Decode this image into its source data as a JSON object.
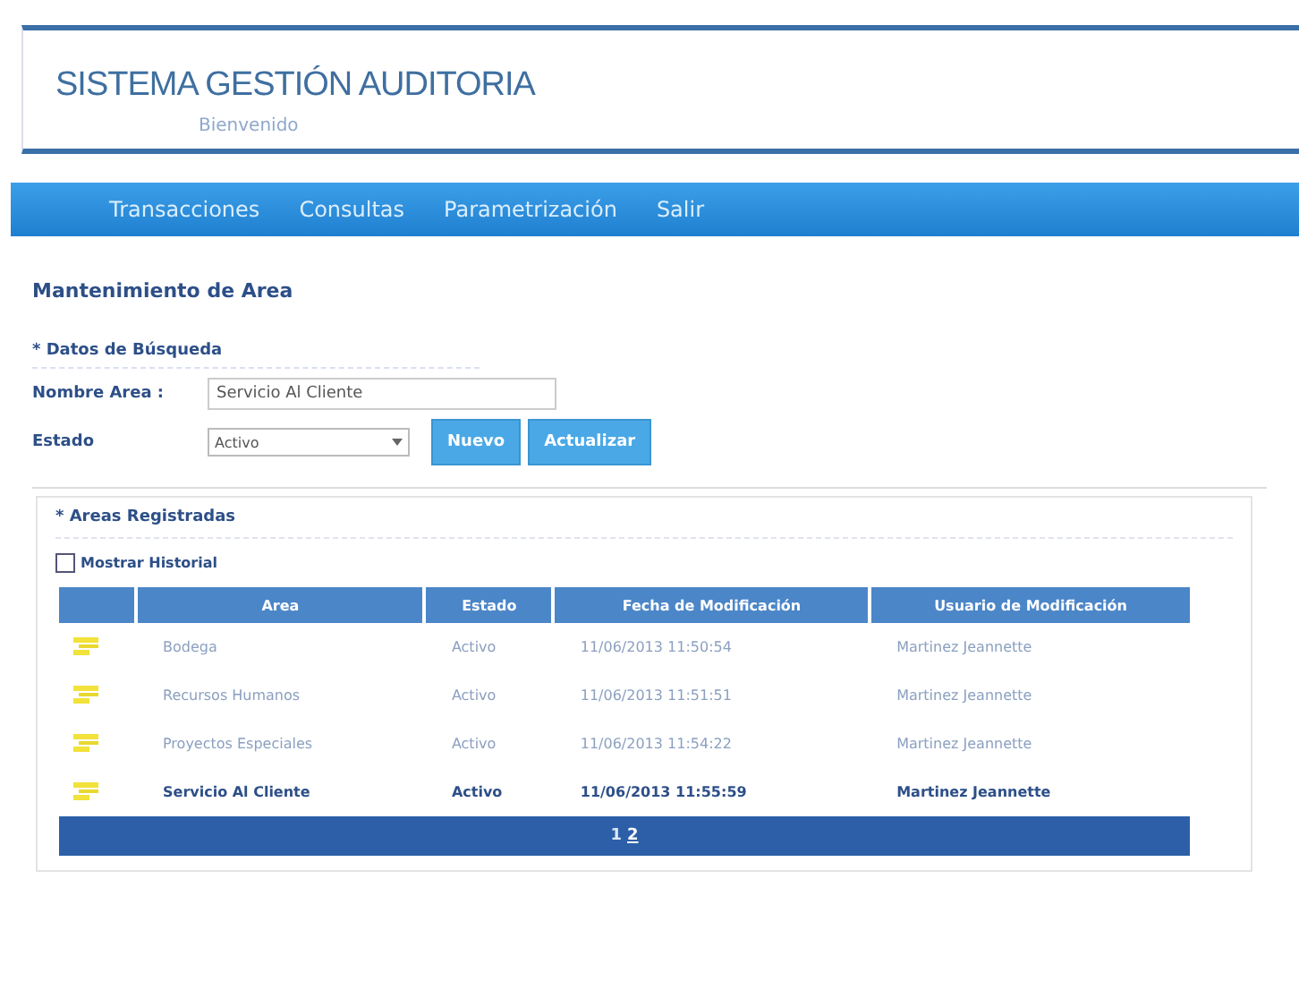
{
  "header": {
    "title": "SISTEMA GESTIÓN AUDITORIA",
    "subtitle": "Bienvenido"
  },
  "nav": {
    "items": [
      {
        "label": "Transacciones"
      },
      {
        "label": "Consultas"
      },
      {
        "label": "Parametrización"
      },
      {
        "label": "Salir"
      }
    ]
  },
  "page_title": "Mantenimiento de Area",
  "search": {
    "heading": "* Datos de Búsqueda",
    "fields": [
      {
        "kind": "text",
        "label": "Nombre Area :",
        "value": "Servicio Al Cliente"
      },
      {
        "kind": "select",
        "label": "Estado",
        "value": "Activo"
      }
    ],
    "buttons": [
      "Nuevo",
      "Actualizar"
    ]
  },
  "results": {
    "heading": "* Areas Registradas",
    "history": {
      "label": "Mostrar Historial",
      "checked": false
    },
    "columns": [
      "Area",
      "Estado",
      "Fecha de Modificación",
      "Usuario de Modificación"
    ],
    "rows": [
      {
        "cells": [
          "Bodega",
          "Activo",
          "11/06/2013 11:50:54",
          "Martinez Jeannette"
        ],
        "selected": false
      },
      {
        "cells": [
          "Recursos Humanos",
          "Activo",
          "11/06/2013 11:51:51",
          "Martinez Jeannette"
        ],
        "selected": false
      },
      {
        "cells": [
          "Proyectos Especiales",
          "Activo",
          "11/06/2013 11:54:22",
          "Martinez Jeannette"
        ],
        "selected": false
      },
      {
        "cells": [
          "Servicio Al Cliente",
          "Activo",
          "11/06/2013 11:55:59",
          "Martinez Jeannette"
        ],
        "selected": true
      }
    ],
    "pages": [
      {
        "label": "1",
        "selected": false
      },
      {
        "label": "2",
        "selected": true
      }
    ]
  }
}
